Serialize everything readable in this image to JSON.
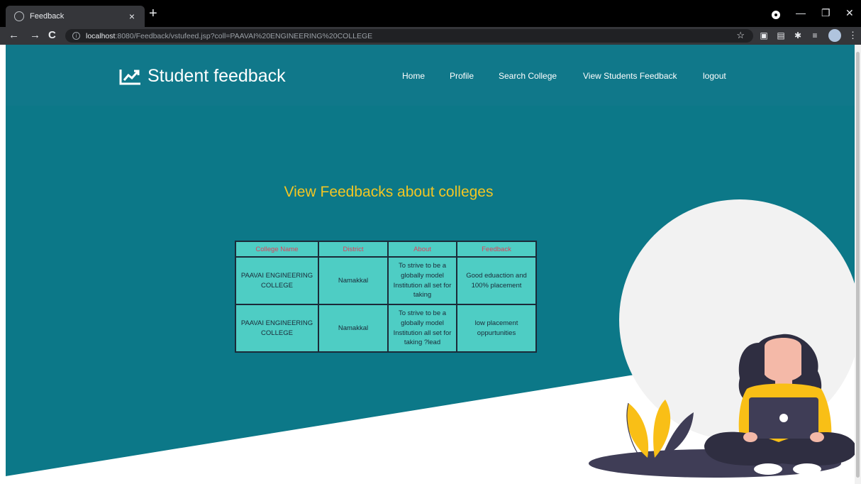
{
  "browser": {
    "tab_title": "Feedback",
    "tab_close": "×",
    "new_tab": "+",
    "url_host": "localhost",
    "url_rest": ":8080/Feedback/vstufeed.jsp?coll=PAAVAI%20ENGINEERING%20COLLEGE"
  },
  "brand": {
    "title": "Student feedback",
    "icon": "chart-line-icon"
  },
  "nav": {
    "home": "Home",
    "profile": "Profile",
    "search": "Search College",
    "view": "View Students Feedback",
    "logout": "logout"
  },
  "heading": "View Feedbacks about colleges",
  "table": {
    "headers": [
      "College Name",
      "District",
      "About",
      "Feedback"
    ],
    "rows": [
      [
        "PAAVAI ENGINEERING COLLEGE",
        "Namakkal",
        "To strive to be a globally model Institution all set for taking",
        "Good eduaction and 100% placement"
      ],
      [
        "PAAVAI ENGINEERING COLLEGE",
        "Namakkal",
        "To strive to be a globally model Institution all set for taking ?lead",
        "low placement oppurtunities"
      ]
    ]
  },
  "colors": {
    "header": "#10788a",
    "hero": "#0c7888",
    "heading": "#f3c623",
    "table_bg": "#4ecdc4",
    "table_header_text": "#e0405a",
    "illustration_yellow": "#f9bf16",
    "illustration_dark": "#3f3d56"
  }
}
